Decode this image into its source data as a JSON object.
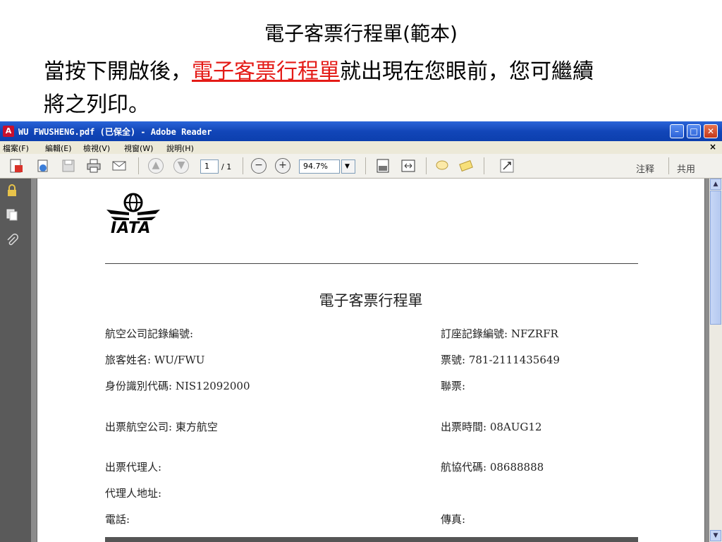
{
  "slide": {
    "title": "電子客票行程單(範本)",
    "line1_before": "當按下開啟後，",
    "line1_highlight": "電子客票行程單",
    "line1_after": "就出現在您眼前，您可繼續",
    "line2": "將之列印。"
  },
  "window": {
    "title": "WU FWUSHENG.pdf (已保全) - Adobe Reader",
    "min": "–",
    "max": "□",
    "close": "✕"
  },
  "menu": {
    "items": [
      "檔案(F)",
      "編輯(E)",
      "檢視(V)",
      "視窗(W)",
      "說明(H)"
    ],
    "doc_close": "×"
  },
  "toolbar": {
    "page_current": "1",
    "page_total": "/ 1",
    "zoom": "94.7%",
    "comment_label": "注释",
    "share_label": "共用"
  },
  "document": {
    "logo_text": "IATA",
    "title": "電子客票行程單",
    "fields": {
      "airline_record_label": "航空公司記錄編號:",
      "booking_record": "訂座記錄編號: NFZRFR",
      "passenger_name": "旅客姓名: WU/FWU",
      "ticket_no": "票號: 781-2111435649",
      "id_code": "身份識別代碼: NIS12092000",
      "conjunction": "聯票:",
      "issuing_airline": "出票航空公司: 東方航空",
      "issue_time": "出票時間: 08AUG12",
      "agent": "出票代理人:",
      "iata_code": "航協代碼: 08688888",
      "agent_address": "代理人地址:",
      "phone": "電話:",
      "fax": "傳真:"
    }
  }
}
